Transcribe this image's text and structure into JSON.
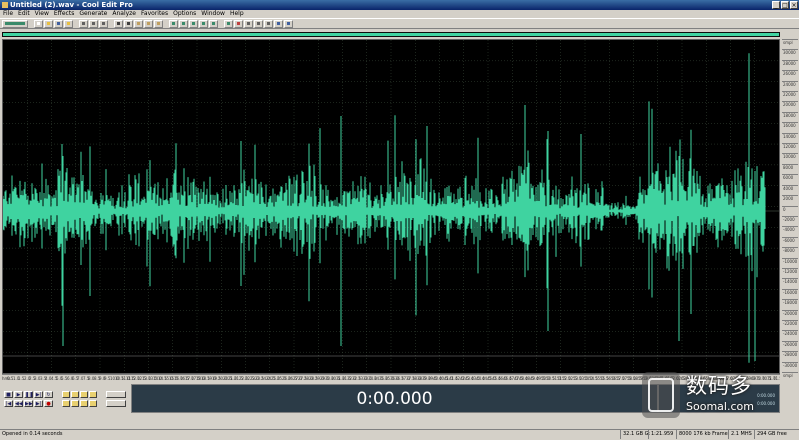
{
  "window": {
    "title": "Untitled (2).wav - Cool Edit Pro"
  },
  "window_controls": [
    "_",
    "□",
    "×"
  ],
  "menu": [
    "File",
    "Edit",
    "View",
    "Effects",
    "Generate",
    "Analyze",
    "Favorites",
    "Options",
    "Window",
    "Help"
  ],
  "colors": {
    "waveform": "#3fd3a0",
    "background": "#000000",
    "grid": "#3a4a3a",
    "display": "#2b3b47"
  },
  "overview": {
    "visible_fraction": 1.0
  },
  "timeline_labels": [
    "hms",
    "0.5",
    "1.0",
    "1.5",
    "2.0",
    "2.5",
    "3.0",
    "3.5",
    "4.0",
    "4.5",
    "5.0",
    "5.5",
    "6.0",
    "6.5",
    "7.0",
    "7.5",
    "8.0",
    "8.5",
    "9.0",
    "9.5",
    "10.0",
    "10.5",
    "11.0",
    "11.5",
    "12.0",
    "12.5",
    "13.0",
    "13.5",
    "14.0",
    "14.5",
    "15.0",
    "15.5",
    "16.0",
    "16.5",
    "17.0",
    "17.5",
    "18.0",
    "18.5",
    "19.0",
    "19.5",
    "20.0",
    "20.5",
    "21.0",
    "21.5",
    "22.0",
    "22.5",
    "23.0",
    "23.5",
    "24.0",
    "24.5",
    "25.0",
    "25.5",
    "26.0",
    "26.5",
    "27.0",
    "27.5",
    "28.0",
    "28.5",
    "29.0",
    "29.5",
    "30.0",
    "30.5",
    "31.0",
    "31.5",
    "32.0",
    "32.5",
    "33.0",
    "33.5",
    "34.0",
    "34.5",
    "35.0",
    "35.5",
    "36.0",
    "36.5",
    "37.0",
    "37.5",
    "38.0",
    "38.5",
    "39.0",
    "39.5",
    "40.0",
    "40.5",
    "41.0",
    "41.5",
    "42.0",
    "42.5",
    "43.0",
    "43.5",
    "44.0",
    "44.5",
    "45.0",
    "45.5",
    "46.0",
    "46.5",
    "47.0",
    "47.5",
    "48.0",
    "48.5",
    "49.0",
    "49.5",
    "50.0",
    "50.5",
    "51.0",
    "51.5",
    "52.0",
    "52.5",
    "53.0",
    "53.5",
    "54.0",
    "54.5",
    "55.0",
    "55.5",
    "56.0",
    "56.5",
    "57.0",
    "57.5",
    "58.0",
    "58.5",
    "59.0",
    "59.5",
    "60.0",
    "60.5",
    "61.0",
    "61.5",
    "62.0",
    "62.5",
    "63.0",
    "63.5",
    "64.0",
    "64.5",
    "65.0",
    "65.5",
    "66.0",
    "66.5",
    "67.0",
    "67.5",
    "68.0",
    "68.5",
    "69.0",
    "69.5",
    "70.0",
    "70.5",
    "71.0",
    "71.5"
  ],
  "amp_labels": [
    "smpl",
    "30000",
    "28000",
    "26000",
    "24000",
    "22000",
    "20000",
    "18000",
    "16000",
    "14000",
    "12000",
    "10000",
    "8000",
    "6000",
    "4000",
    "2000",
    "0",
    "-2000",
    "-4000",
    "-6000",
    "-8000",
    "-10000",
    "-12000",
    "-14000",
    "-16000",
    "-18000",
    "-20000",
    "-22000",
    "-24000",
    "-26000",
    "-28000",
    "-30000",
    "smpl"
  ],
  "transport": {
    "buttons": [
      {
        "name": "stop-button",
        "glyph": "■"
      },
      {
        "name": "play-button",
        "glyph": "▶"
      },
      {
        "name": "pause-button",
        "glyph": "❚❚"
      },
      {
        "name": "play-to-end-button",
        "glyph": "▶|"
      },
      {
        "name": "loop-button",
        "glyph": "↻"
      },
      {
        "name": "goto-start-button",
        "glyph": "|◀"
      },
      {
        "name": "rewind-button",
        "glyph": "◀◀"
      },
      {
        "name": "fast-forward-button",
        "glyph": "▶▶"
      },
      {
        "name": "goto-end-button",
        "glyph": "▶|"
      },
      {
        "name": "record-button",
        "glyph": "●"
      }
    ]
  },
  "time_display": "0:00.000",
  "selection_panel": {
    "begin": "0:00.000",
    "end": "0:00.000"
  },
  "watermark": {
    "cn": "数码多",
    "en": "Soomal.com"
  },
  "status": {
    "left": "Opened in 0.14 seconds",
    "fields": [
      "32.1 GB G:",
      "1:21.959",
      "8000 176 kb Frame",
      "2.1 MHS",
      "294 GB free"
    ]
  }
}
